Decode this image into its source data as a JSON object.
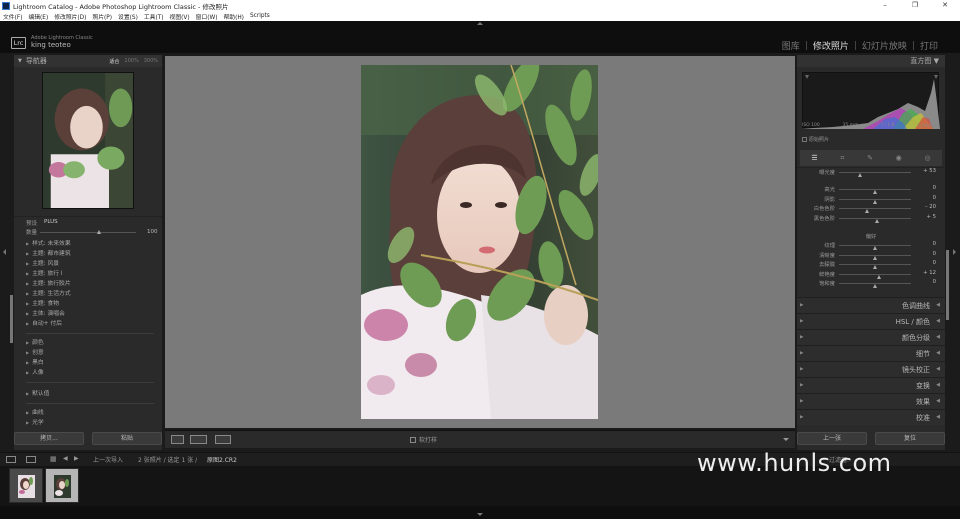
{
  "window": {
    "title": "Lightroom Catalog - Adobe Photoshop Lightroom Classic - 修改照片",
    "controls": [
      "–",
      "❐",
      "✕"
    ]
  },
  "menu": [
    "文件(F)",
    "编辑(E)",
    "修改照片(D)",
    "照片(P)",
    "设置(S)",
    "工具(T)",
    "视图(V)",
    "窗口(W)",
    "帮助(H)",
    "Scripts"
  ],
  "identity": {
    "badge": "Lrc",
    "product": "Adobe Lightroom Classic",
    "user": "king teoteo"
  },
  "modules": {
    "items": [
      "图库",
      "修改照片",
      "幻灯片放映",
      "打印"
    ],
    "separator": "|",
    "active_index": 1
  },
  "navigator": {
    "title": "导航器",
    "zoom": [
      "适合",
      "100%",
      "300%"
    ]
  },
  "presets": {
    "label": "预设",
    "search_tag": "PLUS",
    "amount_label": "数量",
    "amount_value": "100",
    "amount_fraction": 0.62,
    "groups": [
      "样式: 未来效果",
      "主题: 都市建筑",
      "主题: 风景",
      "主题: 旅行 I",
      "主题: 旅行胶片",
      "主题: 生活方式",
      "主题: 食物",
      "主体: 演唱会",
      "自动+ 付后"
    ],
    "groups2": [
      "颜色",
      "创意",
      "黑白",
      "人像"
    ],
    "groups3": [
      "默认值"
    ],
    "groups4": [
      "曲线",
      "光学"
    ]
  },
  "left_buttons": [
    "拷贝...",
    "粘贴"
  ],
  "toolbar": {
    "soft_proof": "软打样"
  },
  "histogram": {
    "title": "直方图",
    "info": [
      "ISO 100",
      "35 mm",
      "f / 1.8",
      "1/1600 秒"
    ],
    "original_label": "原始照片"
  },
  "basic": {
    "top_label": "曝光度",
    "top_value": "+ 53",
    "sliders1": [
      {
        "label": "高光",
        "value": "0",
        "pos": 0.5
      },
      {
        "label": "阴影",
        "value": "0",
        "pos": 0.5
      },
      {
        "label": "白色色阶",
        "value": "– 20",
        "pos": 0.4
      },
      {
        "label": "黑色色阶",
        "value": "+ 5",
        "pos": 0.53
      }
    ],
    "presence_label": "偏好",
    "sliders2": [
      {
        "label": "纹理",
        "value": "0",
        "pos": 0.5
      },
      {
        "label": "清晰度",
        "value": "0",
        "pos": 0.5
      },
      {
        "label": "去朦胧",
        "value": "0",
        "pos": 0.5
      },
      {
        "label": "鲜艳度",
        "value": "+ 12",
        "pos": 0.56
      },
      {
        "label": "饱和度",
        "value": "0",
        "pos": 0.5
      }
    ]
  },
  "sections": [
    "色调曲线",
    "HSL / 颜色",
    "颜色分级",
    "细节",
    "镜头校正",
    "变换",
    "效果",
    "校准"
  ],
  "right_buttons": [
    "上一张",
    "复位"
  ],
  "filmstrip": {
    "monitor_labels": [
      "1",
      "2"
    ],
    "source": "上一次导入",
    "count": "2 张照片 / 选定 1 张 /",
    "filename": "原图2.CR2",
    "filter_label": "过滤器:"
  },
  "watermark": "www.hunls.com",
  "colors": {
    "accent": "#dddddd",
    "panel": "#2a2a2a",
    "center_bg": "#7a7a7a"
  }
}
